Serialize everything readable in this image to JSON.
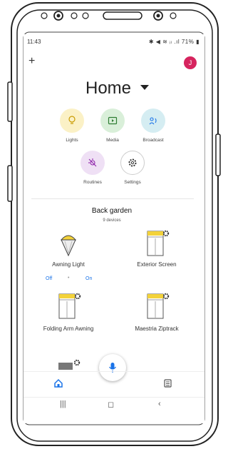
{
  "status": {
    "time": "11:43",
    "icons": "✱ ◀ ≋ ᵢₗ .ıl 71% ▮"
  },
  "header": {
    "title": "Home",
    "avatar_initial": "J"
  },
  "chips": [
    {
      "label": "Lights",
      "icon": "lightbulb-icon",
      "color": "#fbf1c6"
    },
    {
      "label": "Media",
      "icon": "play-icon",
      "color": "#d9efd9"
    },
    {
      "label": "Broadcast",
      "icon": "broadcast-icon",
      "color": "#d5edf2"
    },
    {
      "label": "Routines",
      "icon": "routines-icon",
      "color": "#efe0f5"
    },
    {
      "label": "Settings",
      "icon": "gear-icon",
      "color": "#ffffff"
    }
  ],
  "room": {
    "name": "Back garden",
    "count": "9 devices"
  },
  "devices": [
    {
      "label": "Awning Light",
      "icon": "lamp-icon"
    },
    {
      "label": "Exterior Screen",
      "icon": "screen-icon"
    },
    {
      "label": "Folding Arm Awning",
      "icon": "awning-icon"
    },
    {
      "label": "Maestria Ziptrack",
      "icon": "ziptrack-icon"
    }
  ],
  "toggle": {
    "off": "Off",
    "on": "On"
  },
  "colors": {
    "accent": "#1a73e8",
    "avatar": "#d6245e",
    "awning": "#f3d23a"
  }
}
